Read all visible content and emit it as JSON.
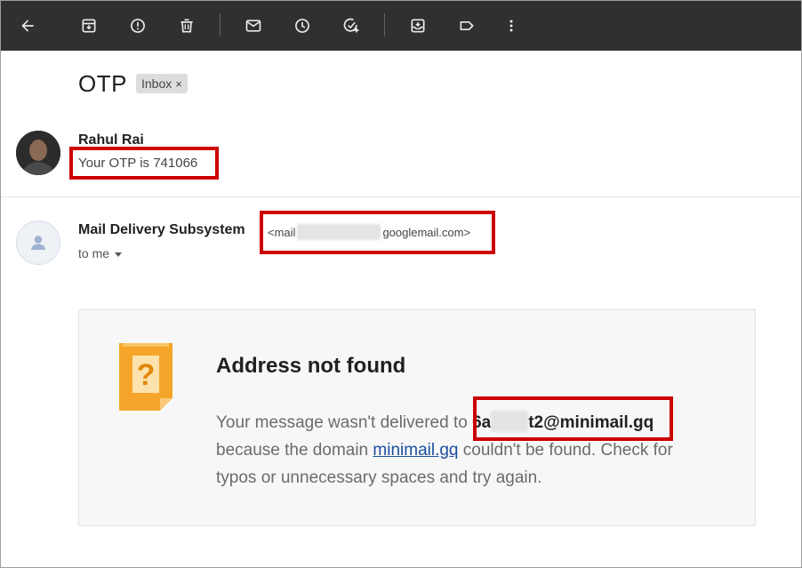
{
  "toolbar": {
    "icons": [
      "back-arrow-icon",
      "archive-icon",
      "report-spam-icon",
      "delete-icon",
      "mark-unread-icon",
      "snooze-icon",
      "add-task-icon",
      "move-to-icon",
      "label-icon",
      "more-vert-icon"
    ]
  },
  "thread": {
    "subject": "OTP",
    "label": "Inbox",
    "label_remove": "×"
  },
  "message1": {
    "sender": "Rahul Rai",
    "snippet": "Your OTP is 741066"
  },
  "message2": {
    "sender": "Mail Delivery Subsystem",
    "email_prefix": "<mail",
    "email_suffix": "googlemail.com>",
    "recipient": "to me"
  },
  "bounce": {
    "title": "Address not found",
    "text_before": "Your message wasn't delivered to ",
    "addr_prefix": "6a",
    "addr_suffix": "t2@minimail.gq",
    "text_mid": " because the domain ",
    "domain_link": "minimail.gq",
    "text_after": " couldn't be found. Check for typos or unnecessary spaces and try again."
  },
  "colors": {
    "toolbar_bg": "#303030",
    "highlight": "#cc0000",
    "warning_icon": "#f4a52a",
    "link": "#1a4fa0"
  }
}
